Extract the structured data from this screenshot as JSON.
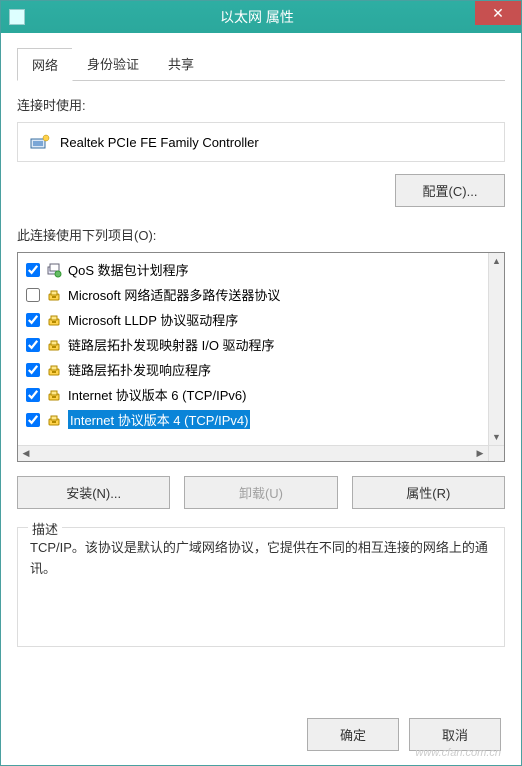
{
  "window": {
    "title": "以太网 属性",
    "close_glyph": "✕"
  },
  "tabs": {
    "network": "网络",
    "auth": "身份验证",
    "sharing": "共享"
  },
  "connect_using_label": "连接时使用:",
  "adapter": {
    "name": "Realtek PCIe FE Family Controller"
  },
  "configure_button": "配置(C)...",
  "items_label": "此连接使用下列项目(O):",
  "items": [
    {
      "checked": true,
      "icon": "service",
      "label": "QoS 数据包计划程序"
    },
    {
      "checked": false,
      "icon": "protocol",
      "label": "Microsoft 网络适配器多路传送器协议"
    },
    {
      "checked": true,
      "icon": "protocol",
      "label": "Microsoft LLDP 协议驱动程序"
    },
    {
      "checked": true,
      "icon": "protocol",
      "label": "链路层拓扑发现映射器 I/O 驱动程序"
    },
    {
      "checked": true,
      "icon": "protocol",
      "label": "链路层拓扑发现响应程序"
    },
    {
      "checked": true,
      "icon": "protocol",
      "label": "Internet 协议版本 6 (TCP/IPv6)"
    },
    {
      "checked": true,
      "icon": "protocol",
      "label": "Internet 协议版本 4 (TCP/IPv4)",
      "selected": true
    }
  ],
  "buttons": {
    "install": "安装(N)...",
    "uninstall": "卸载(U)",
    "properties": "属性(R)",
    "ok": "确定",
    "cancel": "取消"
  },
  "description": {
    "legend": "描述",
    "text": "TCP/IP。该协议是默认的广域网络协议，它提供在不同的相互连接的网络上的通讯。"
  },
  "watermark": "www.cfan.com.cn"
}
